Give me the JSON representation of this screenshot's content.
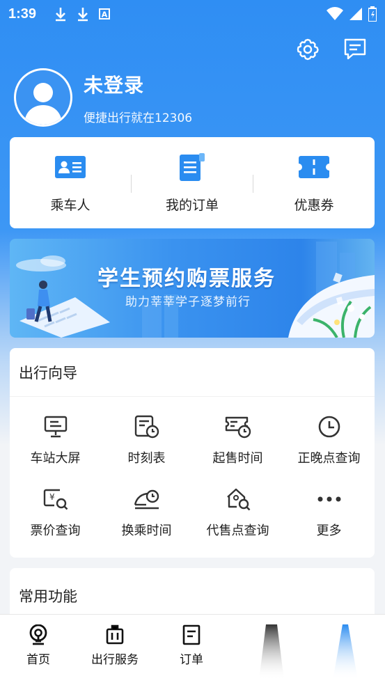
{
  "status_bar": {
    "time": "1:39",
    "left_icons": [
      "download-icon",
      "download-icon",
      "text-a-icon"
    ],
    "right_icons": [
      "wifi-icon",
      "signal-icon",
      "battery-icon"
    ]
  },
  "header": {
    "actions": [
      "settings-icon",
      "message-icon"
    ]
  },
  "profile": {
    "title": "未登录",
    "subtitle": "便捷出行就在12306"
  },
  "quick_links": [
    {
      "label": "乘车人",
      "icon": "passenger-card-icon"
    },
    {
      "label": "我的订单",
      "icon": "order-list-icon"
    },
    {
      "label": "优惠券",
      "icon": "coupon-icon"
    }
  ],
  "banner": {
    "title": "学生预约购票服务",
    "subtitle": "助力莘莘学子逐梦前行"
  },
  "travel_guide": {
    "title": "出行向导",
    "items": [
      {
        "label": "车站大屏",
        "icon": "station-screen-icon"
      },
      {
        "label": "时刻表",
        "icon": "timetable-icon"
      },
      {
        "label": "起售时间",
        "icon": "ticket-sale-time-icon"
      },
      {
        "label": "正晚点查询",
        "icon": "clock-icon"
      },
      {
        "label": "票价查询",
        "icon": "fare-search-icon"
      },
      {
        "label": "换乘时间",
        "icon": "transfer-time-icon"
      },
      {
        "label": "代售点查询",
        "icon": "agency-search-icon"
      },
      {
        "label": "更多",
        "icon": "more-dots-icon"
      }
    ]
  },
  "common_functions": {
    "title": "常用功能"
  },
  "bottom_nav": [
    {
      "label": "首页",
      "icon": "home-train-icon"
    },
    {
      "label": "出行服务",
      "icon": "luggage-icon"
    },
    {
      "label": "订单",
      "icon": "order-doc-icon"
    }
  ],
  "colors": {
    "brand_blue": "#2f8ef3",
    "icon_blue": "#2a8cf0",
    "text": "#222222"
  }
}
